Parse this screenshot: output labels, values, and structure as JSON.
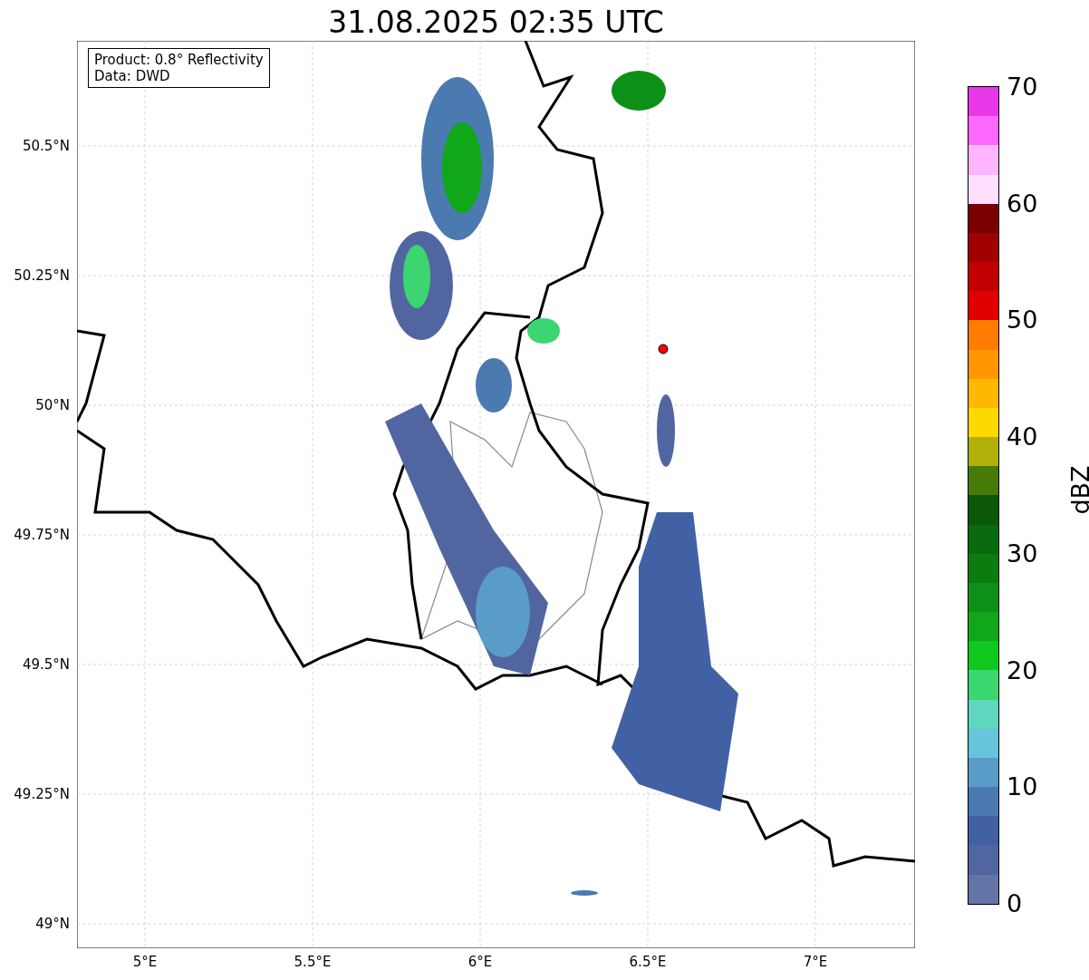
{
  "title": "31.08.2025 02:35 UTC",
  "info_box": {
    "lines": [
      "Product: 0.8° Reflectivity",
      "Data: DWD"
    ]
  },
  "map": {
    "y_ticks": [
      "50.5°N",
      "50.25°N",
      "50°N",
      "49.75°N",
      "49.5°N",
      "49.25°N",
      "49°N"
    ],
    "x_ticks": [
      "5°E",
      "5.5°E",
      "6°E",
      "6.5°E",
      "7°E"
    ]
  },
  "colorbar": {
    "label": "dBZ",
    "ticks": [
      "70",
      "60",
      "50",
      "40",
      "30",
      "20",
      "10",
      "0"
    ],
    "segments": [
      {
        "color": "#6374a8"
      },
      {
        "color": "#5166a0"
      },
      {
        "color": "#4260a4"
      },
      {
        "color": "#4a7ab0"
      },
      {
        "color": "#5a9cc8"
      },
      {
        "color": "#66c4dc"
      },
      {
        "color": "#60d8c0"
      },
      {
        "color": "#3cd670"
      },
      {
        "color": "#10c820"
      },
      {
        "color": "#10a818"
      },
      {
        "color": "#0c9018"
      },
      {
        "color": "#0a7c10"
      },
      {
        "color": "#086a0c"
      },
      {
        "color": "#085808"
      },
      {
        "color": "#487a08"
      },
      {
        "color": "#b0b008"
      },
      {
        "color": "#ffd800"
      },
      {
        "color": "#ffb800"
      },
      {
        "color": "#ff9800"
      },
      {
        "color": "#ff7c00"
      },
      {
        "color": "#e00000"
      },
      {
        "color": "#c00000"
      },
      {
        "color": "#a00000"
      },
      {
        "color": "#7a0000"
      },
      {
        "color": "#ffe0ff"
      },
      {
        "color": "#ffb4ff"
      },
      {
        "color": "#ff68ff"
      },
      {
        "color": "#e838e8"
      }
    ]
  }
}
